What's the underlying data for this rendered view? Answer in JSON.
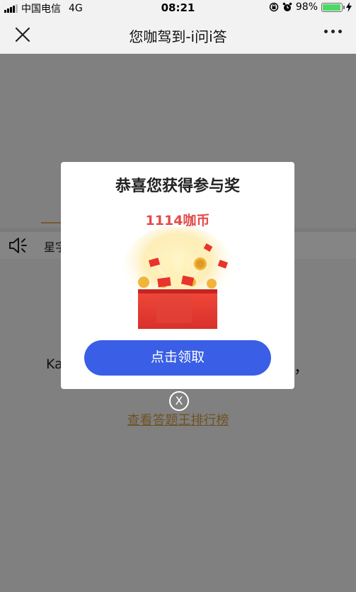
{
  "status_bar": {
    "carrier": "中国电信",
    "network": "4G",
    "time": "08:21",
    "battery_percent": "98%",
    "battery_level": 0.98,
    "icons": [
      "signal-icon",
      "lock-rotation-icon",
      "alarm-icon",
      "battery-icon",
      "charging-icon"
    ]
  },
  "nav": {
    "title": "您咖驾到-i问i答",
    "close_icon": "close-icon",
    "more_icon": "more-icon"
  },
  "background": {
    "notice_prefix": "星字",
    "text_left": "Ka",
    "text_right": "，",
    "ranking_link": "查看答题王排行榜"
  },
  "dialog": {
    "title": "恭喜您获得参与奖",
    "reward_amount": "1114咖币",
    "claim_button": "点击领取",
    "close_label": "X"
  },
  "colors": {
    "accent_button": "#3a5fe6",
    "reward_red": "#e34b4b",
    "overlay_gray": "#808080",
    "link_brown": "#6e5224"
  }
}
